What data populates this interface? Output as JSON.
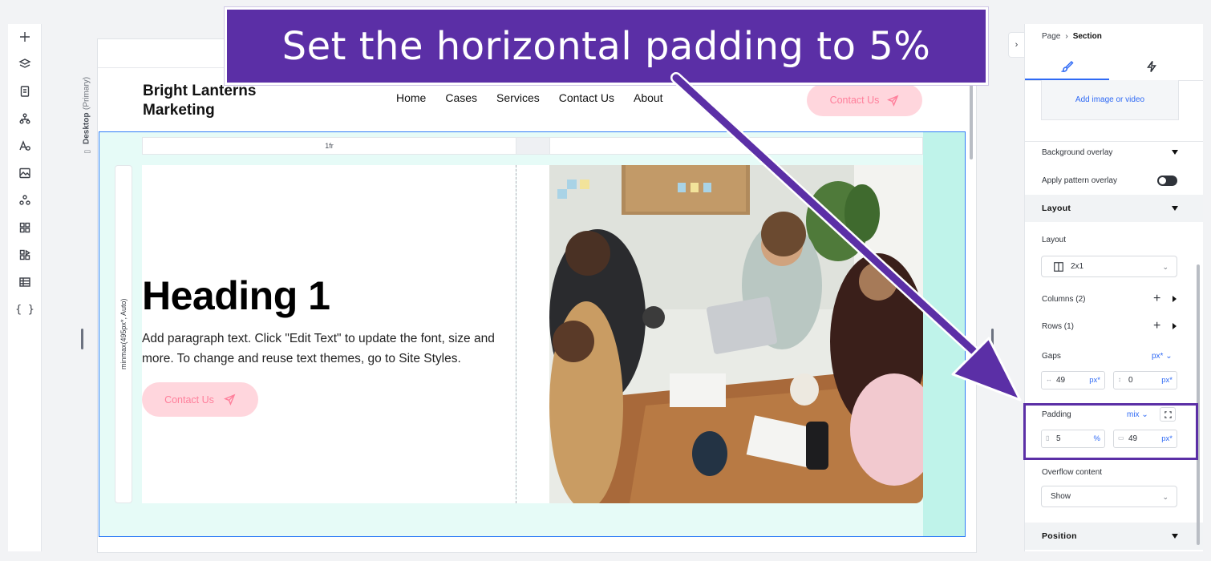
{
  "banner": {
    "text": "Set the horizontal padding to 5%"
  },
  "toolbar": {
    "icons": [
      "add-icon",
      "layers-icon",
      "pages-icon",
      "site-structure-icon",
      "text-theme-icon",
      "media-icon",
      "apps-icon",
      "app-market-icon",
      "widgets-icon",
      "cms-icon",
      "code-icon"
    ]
  },
  "canvas": {
    "device_label": "Desktop",
    "device_note": "(Primary)",
    "site": {
      "logo_line1": "Bright Lanterns",
      "logo_line2": "Marketing",
      "nav": [
        "Home",
        "Cases",
        "Services",
        "Contact Us",
        "About"
      ],
      "header_button": "Contact Us",
      "grid_col_label": "1fr",
      "grid_row_label": "minmax(495px*, Auto)",
      "heading": "Heading 1",
      "paragraph": "Add paragraph text. Click \"Edit Text\" to update the font, size and more. To change and reuse text themes, go to Site Styles.",
      "cta_button": "Contact Us"
    }
  },
  "panel": {
    "breadcrumb_page": "Page",
    "breadcrumb_sep": "›",
    "breadcrumb_current": "Section",
    "tabs": [
      "design-tab",
      "interactions-tab"
    ],
    "add_media": "Add image or video",
    "background_overlay": "Background overlay",
    "apply_pattern_overlay": "Apply pattern overlay",
    "pattern_overlay_on": true,
    "layout_group": "Layout",
    "layout_label": "Layout",
    "layout_value": "2x1",
    "columns_label": "Columns (2)",
    "rows_label": "Rows (1)",
    "gaps_label": "Gaps",
    "gaps_unit": "px*",
    "gap_horizontal": "49",
    "gap_horizontal_unit": "px*",
    "gap_vertical": "0",
    "gap_vertical_unit": "px*",
    "padding_label": "Padding",
    "padding_unit": "mix",
    "padding_horizontal": "5",
    "padding_horizontal_unit": "%",
    "padding_vertical": "49",
    "padding_vertical_unit": "px*",
    "overflow_label": "Overflow content",
    "overflow_value": "Show",
    "position_group": "Position"
  },
  "colors": {
    "accent": "#5b2fa6",
    "link_blue": "#2f6af5",
    "button_pink": "#ffd6dd",
    "button_text": "#ff7f9b",
    "section_bg": "#e6fbf7",
    "selection_blue": "#2f7cf6"
  }
}
